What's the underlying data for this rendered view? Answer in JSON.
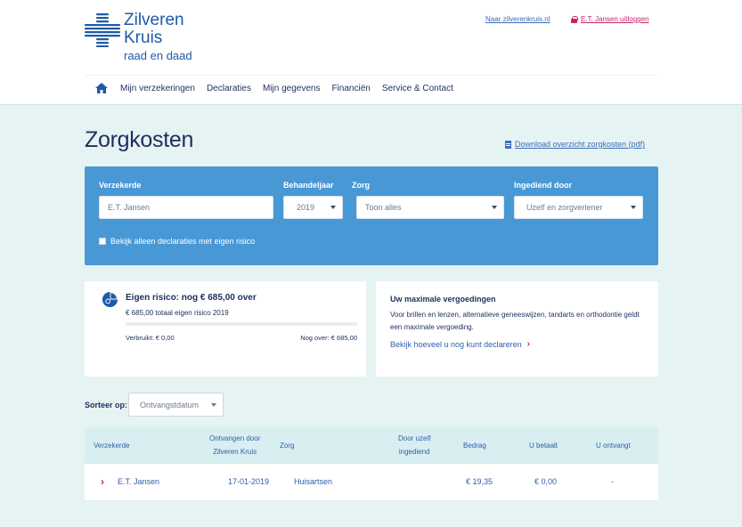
{
  "brand": {
    "line1": "Zilveren",
    "line2": "Kruis",
    "line3": "raad en daad",
    "color": "#1e5aa8"
  },
  "toplinks": {
    "site": "Naar zilverenkruis.nl",
    "logout": "E.T. Jansen uitloggen"
  },
  "nav": {
    "items": [
      {
        "label": "Mijn verzekeringen"
      },
      {
        "label": "Declaraties"
      },
      {
        "label": "Mijn gegevens"
      },
      {
        "label": "Financiën"
      },
      {
        "label": "Service & Contact"
      }
    ]
  },
  "page": {
    "title": "Zorgkosten",
    "pdf_link": "Download overzicht zorgkosten (pdf)"
  },
  "filter": {
    "insured_label": "Verzekerde",
    "insured_value": "E.T. Jansen",
    "year_label": "Behandeljaar",
    "year_value": "2019",
    "care_label": "Zorg",
    "care_value": "Toon alles",
    "submitted_label": "Ingediend door",
    "submitted_value": "Uzelf en zorgverlener",
    "checkbox_label": "Bekijk alleen declaraties met eigen risico",
    "checkbox_checked": false,
    "panel_color": "#4898d6"
  },
  "eigen_risico": {
    "title": "Eigen risico: nog € 685,00 over",
    "subtitle": "€ 685,00 totaal eigen risico 2019",
    "used": "Verbruikt: € 0,00",
    "remaining": "Nog over: € 685,00",
    "used_fraction": 0
  },
  "max_vergoeding": {
    "title": "Uw maximale vergoedingen",
    "text": "Voor brillen en lenzen, alternatieve geneeswijzen, tandarts en orthodontie geldt een maximale vergoeding.",
    "link": "Bekijk hoeveel u nog kunt declareren"
  },
  "sort": {
    "label": "Sorteer op:",
    "value": "Ontvangstdatum"
  },
  "table": {
    "headers": {
      "insured": "Verzekerde",
      "received_1": "Ontvangen door",
      "received_2": "Zilveren Kruis",
      "care": "Zorg",
      "self_1": "Door uzelf",
      "self_2": "ingediend",
      "amount": "Bedrag",
      "you_pay": "U betaalt",
      "you_receive": "U ontvangt"
    },
    "rows": [
      {
        "insured": "E.T. Jansen",
        "received": "17-01-2019",
        "care": "Huisartsen",
        "self": "",
        "amount": "€ 19,35",
        "you_pay": "€ 0,00",
        "you_receive": "-"
      }
    ]
  },
  "accent_color": "#c7256a"
}
